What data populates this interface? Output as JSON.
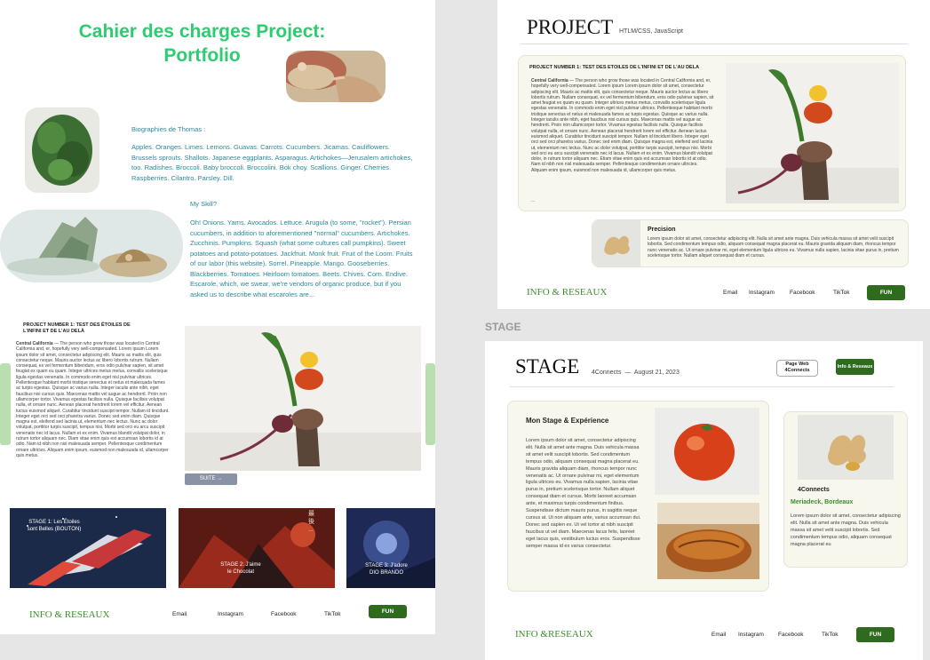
{
  "left": {
    "title_line1": "Cahier des charges Project:",
    "title_line2": "Portfolio",
    "bio_heading": "Biographies de Thomas :",
    "bio_text": "Apples. Oranges. Limes. Lemons. Guavas. Carrots. Cucumbers. Jicamas. Cauliflowers. Brussels sprouts. Shallots. Japanese eggplants. Asparagus. Artichokes—Jerusalem artichokes, too. Radishes. Broccoli. Baby broccoli. Broccolini. Bok choy. Scallions. Ginger. Cherries. Raspberries. Cilantro. Parsley. Dill.",
    "skill_heading": "My Skill?",
    "skill_text": "Oh! Onions. Yams. Avocados. Lettuce. Arugula (to some, \"rocket\"). Persian cucumbers, in addition to aforementioned \"normal\" cucumbers. Artichokes. Zucchinis. Pumpkins. Squash (what some cultures call pumpkins). Sweet potatoes and potato-potatoes. Jackfruit. Monk fruit. Fruit of the Loom. Fruits of our labor (this website). Sorrel. Pineapple. Mango. Gooseberries. Blackberries. Tomatoes. Heirloom tomatoes. Beets. Chives. Corn. Endive. Escarole, which, we swear, we're vendors of organic produce, but if you asked us to describe what escaroles are...",
    "project_heading": "PROJECT NUMBER 1: TEST DES ÉTOILES DE L'INFINI ET DE L'AU DELÀ",
    "project_lead": "Central California",
    "project_text": " — The person who grew those was located in Central California and, er, hopefully very well-compensated. Lorem ipsum Lorem ipsum dolor sit amet, consectetur adipiscing elit. Mauris ac mattis elit, quis consectetur neque. Mauris auctor lectus ac libero lobortis rutrum. Nullam consequat, ex vel fermentum bibendum, eros odio pulvinar sapien, sit amet feugiat ex quam eu quam. Integer ultrices metus metus, convallis scelerisque ligula egestas venenatis. In commodo enim eget nisl pulvinar ultrices. Pellentesque habitant morbi tristique senectus et netus et malesuada fames ac turpis egestas. Quisque ac varius nulla. Integer iaculis ante nibh, eget faucibus nisi cursus quis. Maecenas mattis vel augue ac hendrerit. Proin non ullamcorper tortor. Vivamus egestas facilisis nulla. Quisque facilisis volutpat nulla, et ornare nunc. Aenean placerat hendrerit lorem vel efficitur. Aenean luctus euismod aliquet. Curabitur tincidunt suscipit tempor. Nullam id tincidunt. Integer eget orci sed orci pharetra varius. Donec sed enim diam. Quisque magna est, eleifend sed lacinia ut, elementum nec lectus. Nunc ac dolor volutpat, porttitor turpis suscipit, tempus nisi. Morbi sed orci eu arcu suscipit venenatis nec id lacus. Nullam et ex enim. Vivamus blandit volutpat dolor, in rutrum tortor aliquam nec. Diam vitae enim quis est accumsan lobortis id at odio. Nam id nibh non nisl malesuada semper. Pellentesque condimentum ornare ultricies. Aliquam enim ipsum, euismod non malesuada id, ullamcorper quis metus.",
    "suite_button": "SUITE →",
    "stage1": "STAGE 1: Les Étoiles sont Belles (BOUTON)",
    "stage2": "STAGE 2: J'aime le Chocolat",
    "stage3": "STAGE 3: J'adore DIO BRANDO",
    "poster_text": "最 後 ...",
    "footer_brand": "INFO & RESEAUX",
    "nav": [
      "Email",
      "Instagram",
      "Facebook",
      "TikTok"
    ],
    "fun_button": "FUN"
  },
  "top_right": {
    "title": "PROJECT",
    "subtitle": "HTLM/CSS, JavaScript",
    "card_heading": "PROJECT NUMBER 1: TEST DES ÉTOILES DE L'INFINI ET DE L'AU DELÀ",
    "card_lead": "Central California",
    "card_text": " — The person who grow those was located in Central California and, er, hopefully very well-compensated. Lorem ipsum Lorem ipsum dolor sit amet, consectetur adipiscing elit. Mauris ac mattis elit, quis consectetur neque. Mauris auctor lectus ac libero lobortis rutrum. Nullam consequat, ex vel fermentum bibendum, eros odio pulvinar sapien, sit amet feugiat ex quam eu quam. Integer ultrices metus metus, convallis scelerisque ligula egestas venenatis. In commodo enim eget nisl pulvinar ultrices. Pellentesque habitant morbi tristique senectus et netus et malesuada fames ac turpis egestas. Quisque ac varius nulla. Integer iaculis ante nibh, eget faucibus nisi cursus quis. Maecenas mattis vel augue ac hendrerit. Proin non ullamcorper tortor. Vivamus egestas facilisis nulla. Quisque facilisis volutpat nulla, et ornare nunc. Aenean placerat hendrerit lorem vel efficitur. Aenean luctus euismod aliquet. Curabitur tincidunt suscipit tempor. Nullam id tincidunt libero. Integer eget orci sed orci pharetra varius. Donec sed enim diam. Quisque magna est, eleifend sed lacinia ut, elementum nec lectus. Nunc ac dolor volutpat, porttitor turpis suscipit, tempus nisi. Morbi sed orci eu arcu suscipit venenatis nec id lacus. Nullam et ex enim. Vivamus blandit volutpat dolor, in rutrum tortor aliquam nec. Etiam vitae enim quis est accumsan lobortis id at odio. Nam id nibh non nisl malesuada semper. Pellentesque condimentum ornare ultricies. Aliquam enim ipsum, euismod non malesuada id, ullamcorper quis metus.",
    "card_ellipsis": "...",
    "precision_title": "Precision",
    "precision_text": "Lorem ipsum dolor sit amet, consectetur adipiscing elit. Nulla sit amet ante magna. Duis vehicula massa sit amet velit suscipit lobortis. Sed condimentum tempus odio, aliquam consequat magna placerat eu. Mauris gravida aliquam diam, rhoncus tempor nunc venenatis ac. Ut ornare pulvinar mi, eget elementum ligula ultrices eu. Vivamus nulla sapien, lacinia vitae purus in, pretium scelerisque tortor. Nullam aliquet consequat diam et cursus.",
    "footer_brand": "INFO & RESEAUX",
    "nav": [
      "Email",
      "Instagram",
      "Facebook",
      "TikTok"
    ],
    "fun_button": "FUN"
  },
  "stage_label": "STAGE",
  "bottom_right": {
    "title": "STAGE",
    "company_date": "4Connects  —  August 21, 2023",
    "page_web_button": "Page Web 4Connects",
    "info_button": "Info & Reseaux",
    "main_heading": "Mon Stage & Expérience",
    "main_text": "Lorem ipsum dolor sit amet, consectetur adipiscing elit. Nulla sit amet ante magna. Duis vehicula massa sit amet velit suscipit lobortis. Sed condimentum tempus odio, aliquam consequat magna placerat eu. Mauris gravida aliquam diam, rhoncus tempor nunc venenatis ac. Ut ornare pulvinar mi, eget elementum ligula ultrices eu. Vivamus nulla sapien, lacinia vitae purus in, pretium scelerisque tortor. Nullam aliquet consequat diam et cursus. Morbi laoreet accumsan ante, et maximus turpis condimentum finibus. Suspendisse dictum mauris purus, in sagittis neque cursus at. Ut non aliquam ante, varius accumsan dui. Donec sed sapien ex. Ut vel tortor at nibh suscipit faucibus ut vel diam. Maecenas lacus felis, laoreet eget lacus quis, vestibulum luctus eros. Suspendisse semper massa id ex varius consectetur.",
    "company_name": "4Connects",
    "company_location": "Meriadeck, Bordeaux",
    "company_text": "Lorem ipsum dolor sit amet, consectetur adipiscing elit. Nulla sit amet ante magna. Duis vehicula massa sit amet velit suscipit lobortis. Sed condimentum tempus odio, aliquam consequat magna placerat eu",
    "footer_brand": "INFO &RESEAUX",
    "nav": [
      "Email",
      "Instagram",
      "Facebook",
      "TikTok"
    ],
    "fun_button": "FUN"
  },
  "colors": {
    "title_green": "#2ecc71",
    "teal_text": "#2a8a99",
    "footer_green": "#3e8e2f",
    "button_green": "#2f6b1f"
  }
}
